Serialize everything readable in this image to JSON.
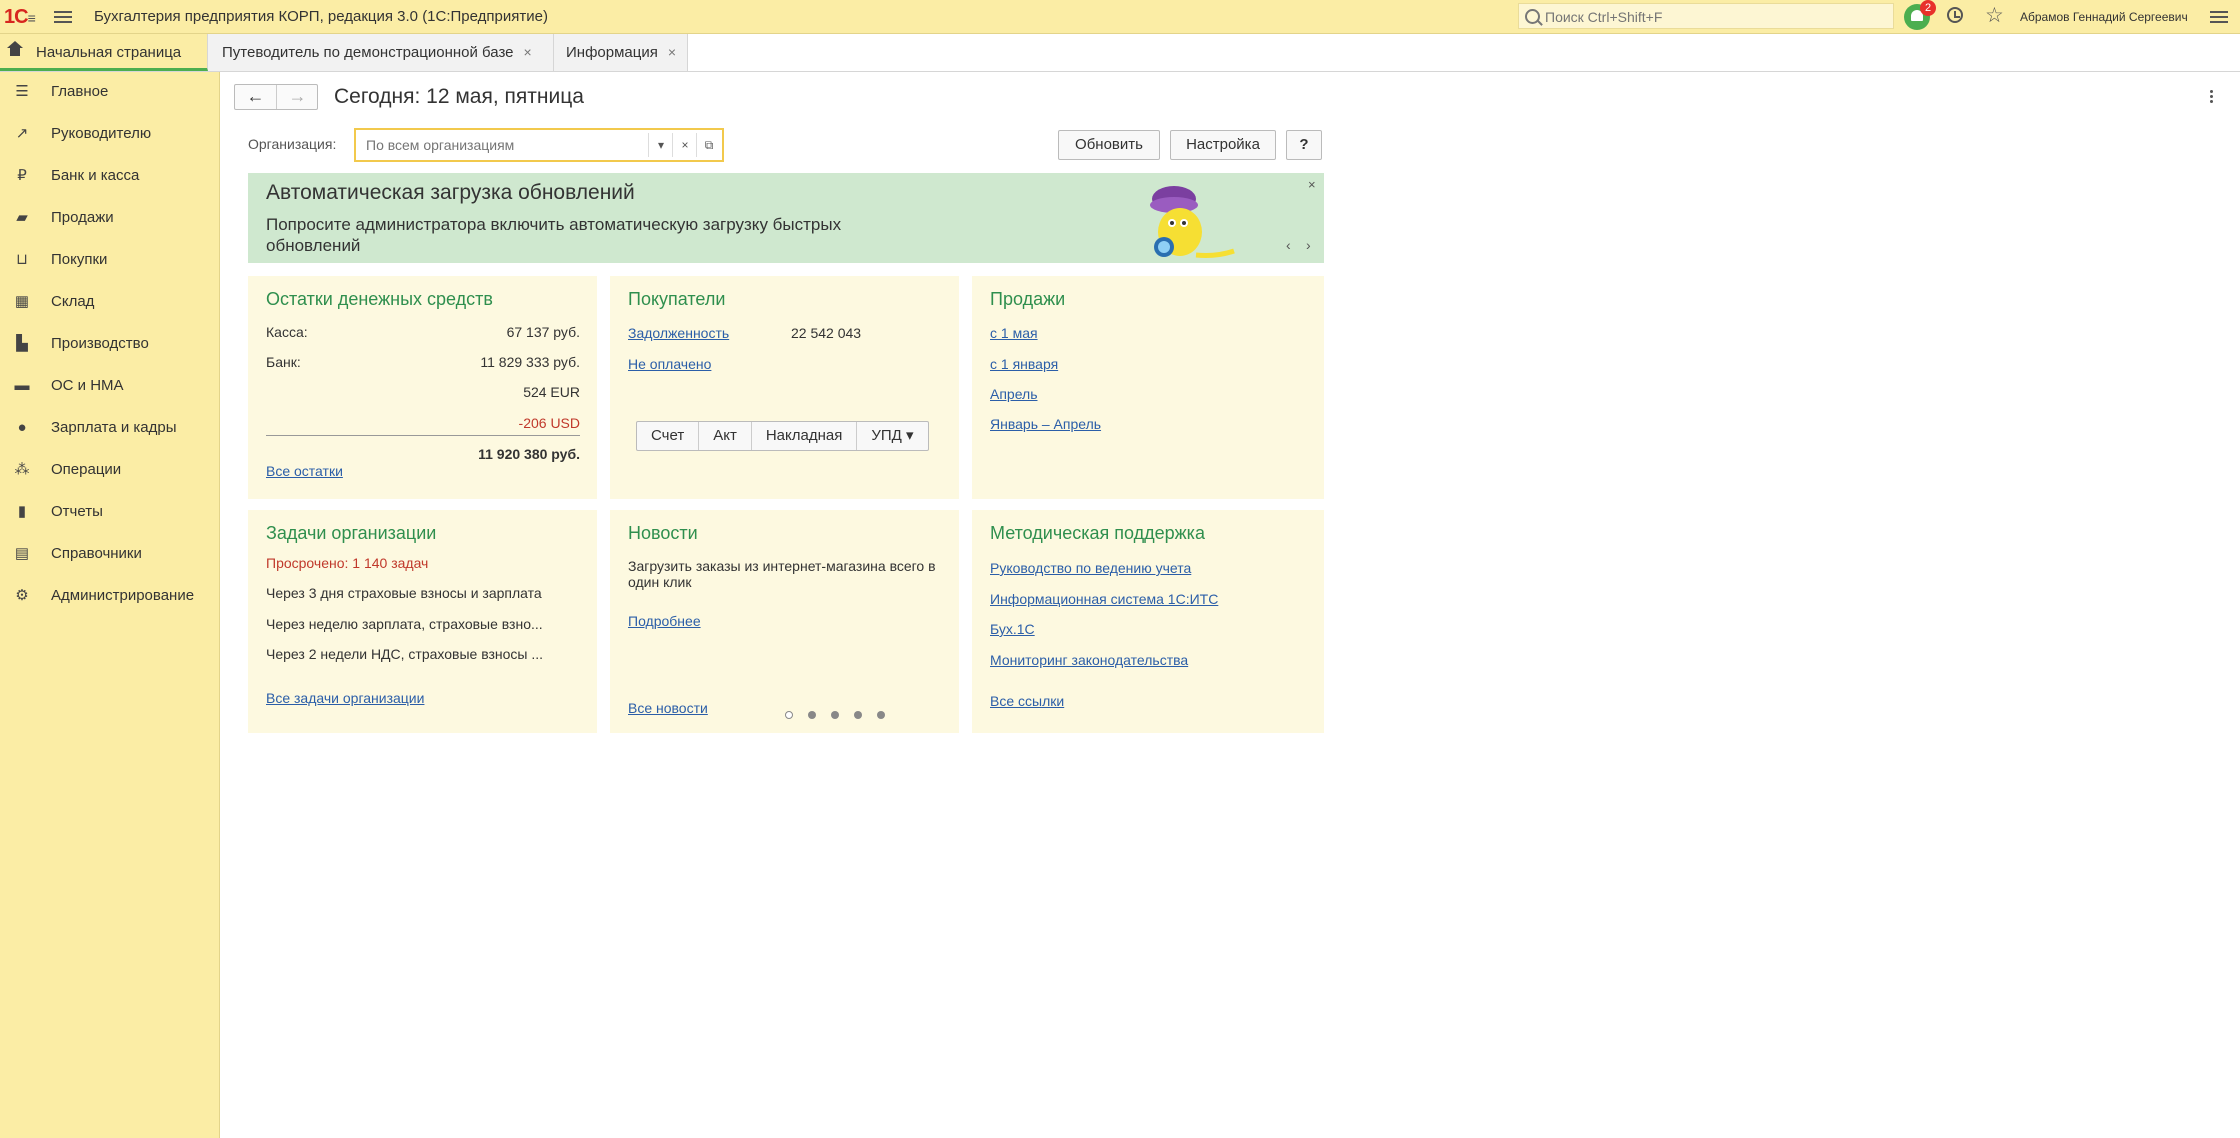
{
  "app": {
    "logo": "1С",
    "title": "Бухгалтерия предприятия КОРП, редакция 3.0  (1С:Предприятие)",
    "search_placeholder": "Поиск Ctrl+Shift+F",
    "notifications_count": "2",
    "user": "Абрамов Геннадий Сергеевич"
  },
  "tabs": [
    {
      "label": "Начальная страница"
    },
    {
      "label": "Путеводитель по демонстрационной базе",
      "close": "×"
    },
    {
      "label": "Информация",
      "close": "×"
    }
  ],
  "sidebar": {
    "items": [
      {
        "label": "Главное",
        "icon": "menu-icon"
      },
      {
        "label": "Руководителю",
        "icon": "trend-icon"
      },
      {
        "label": "Банк и касса",
        "icon": "ruble-coin-icon"
      },
      {
        "label": "Продажи",
        "icon": "bag-icon"
      },
      {
        "label": "Покупки",
        "icon": "cart-icon"
      },
      {
        "label": "Склад",
        "icon": "grid-icon"
      },
      {
        "label": "Производство",
        "icon": "factory-icon"
      },
      {
        "label": "ОС и НМА",
        "icon": "truck-icon"
      },
      {
        "label": "Зарплата и кадры",
        "icon": "person-icon"
      },
      {
        "label": "Операции",
        "icon": "operations-icon"
      },
      {
        "label": "Отчеты",
        "icon": "bar-chart-icon"
      },
      {
        "label": "Справочники",
        "icon": "book-icon"
      },
      {
        "label": "Администрирование",
        "icon": "gear-icon"
      }
    ]
  },
  "main": {
    "back": "←",
    "forward": "→",
    "title": "Сегодня: 12 мая, пятница",
    "org_label": "Организация:",
    "org_placeholder": "По всем организациям",
    "org_dropdown": "▾",
    "org_clear": "×",
    "org_open": "⧉",
    "refresh": "Обновить",
    "settings": "Настройка",
    "help": "?"
  },
  "banner": {
    "title": "Автоматическая загрузка обновлений",
    "text": "Попросите администратора включить автоматическую загрузку быстрых обновлений",
    "close": "×",
    "prev": "‹",
    "next": "›"
  },
  "cash": {
    "title": "Остатки денежных средств",
    "kassa_label": "Касса:",
    "kassa_value": "67 137 руб.",
    "bank_label": "Банк:",
    "bank_rub": "11 829 333 руб.",
    "bank_eur": "524 EUR",
    "bank_usd": "-206 USD",
    "total": "11 920 380 руб.",
    "all_link": "Все остатки"
  },
  "customers": {
    "title": "Покупатели",
    "debt_link": "Задолженность",
    "debt_value": "22 542 043",
    "unpaid_link": "Не оплачено",
    "buttons": [
      "Счет",
      "Акт",
      "Накладная",
      "УПД ▾"
    ]
  },
  "sales": {
    "title": "Продажи",
    "links": [
      "с 1 мая",
      "с 1 января",
      "Апрель",
      "Январь – Апрель"
    ]
  },
  "tasks": {
    "title": "Задачи организации",
    "overdue": "Просрочено: 1 140 задач",
    "items": [
      "Через 3 дня страховые взносы и зарплата",
      "Через неделю зарплата, страховые взно...",
      "Через 2 недели НДС, страховые взносы ..."
    ],
    "all_link": "Все задачи организации"
  },
  "news": {
    "title": "Новости",
    "text": "Загрузить заказы из интернет-магазина всего в один клик",
    "more_link": "Подробнее",
    "all_link": "Все новости"
  },
  "support": {
    "title": "Методическая поддержка",
    "links": [
      "Руководство по ведению учета",
      "Информационная система 1С:ИТС",
      "Бух.1С",
      "Мониторинг законодательства"
    ],
    "all_link": "Все ссылки"
  }
}
